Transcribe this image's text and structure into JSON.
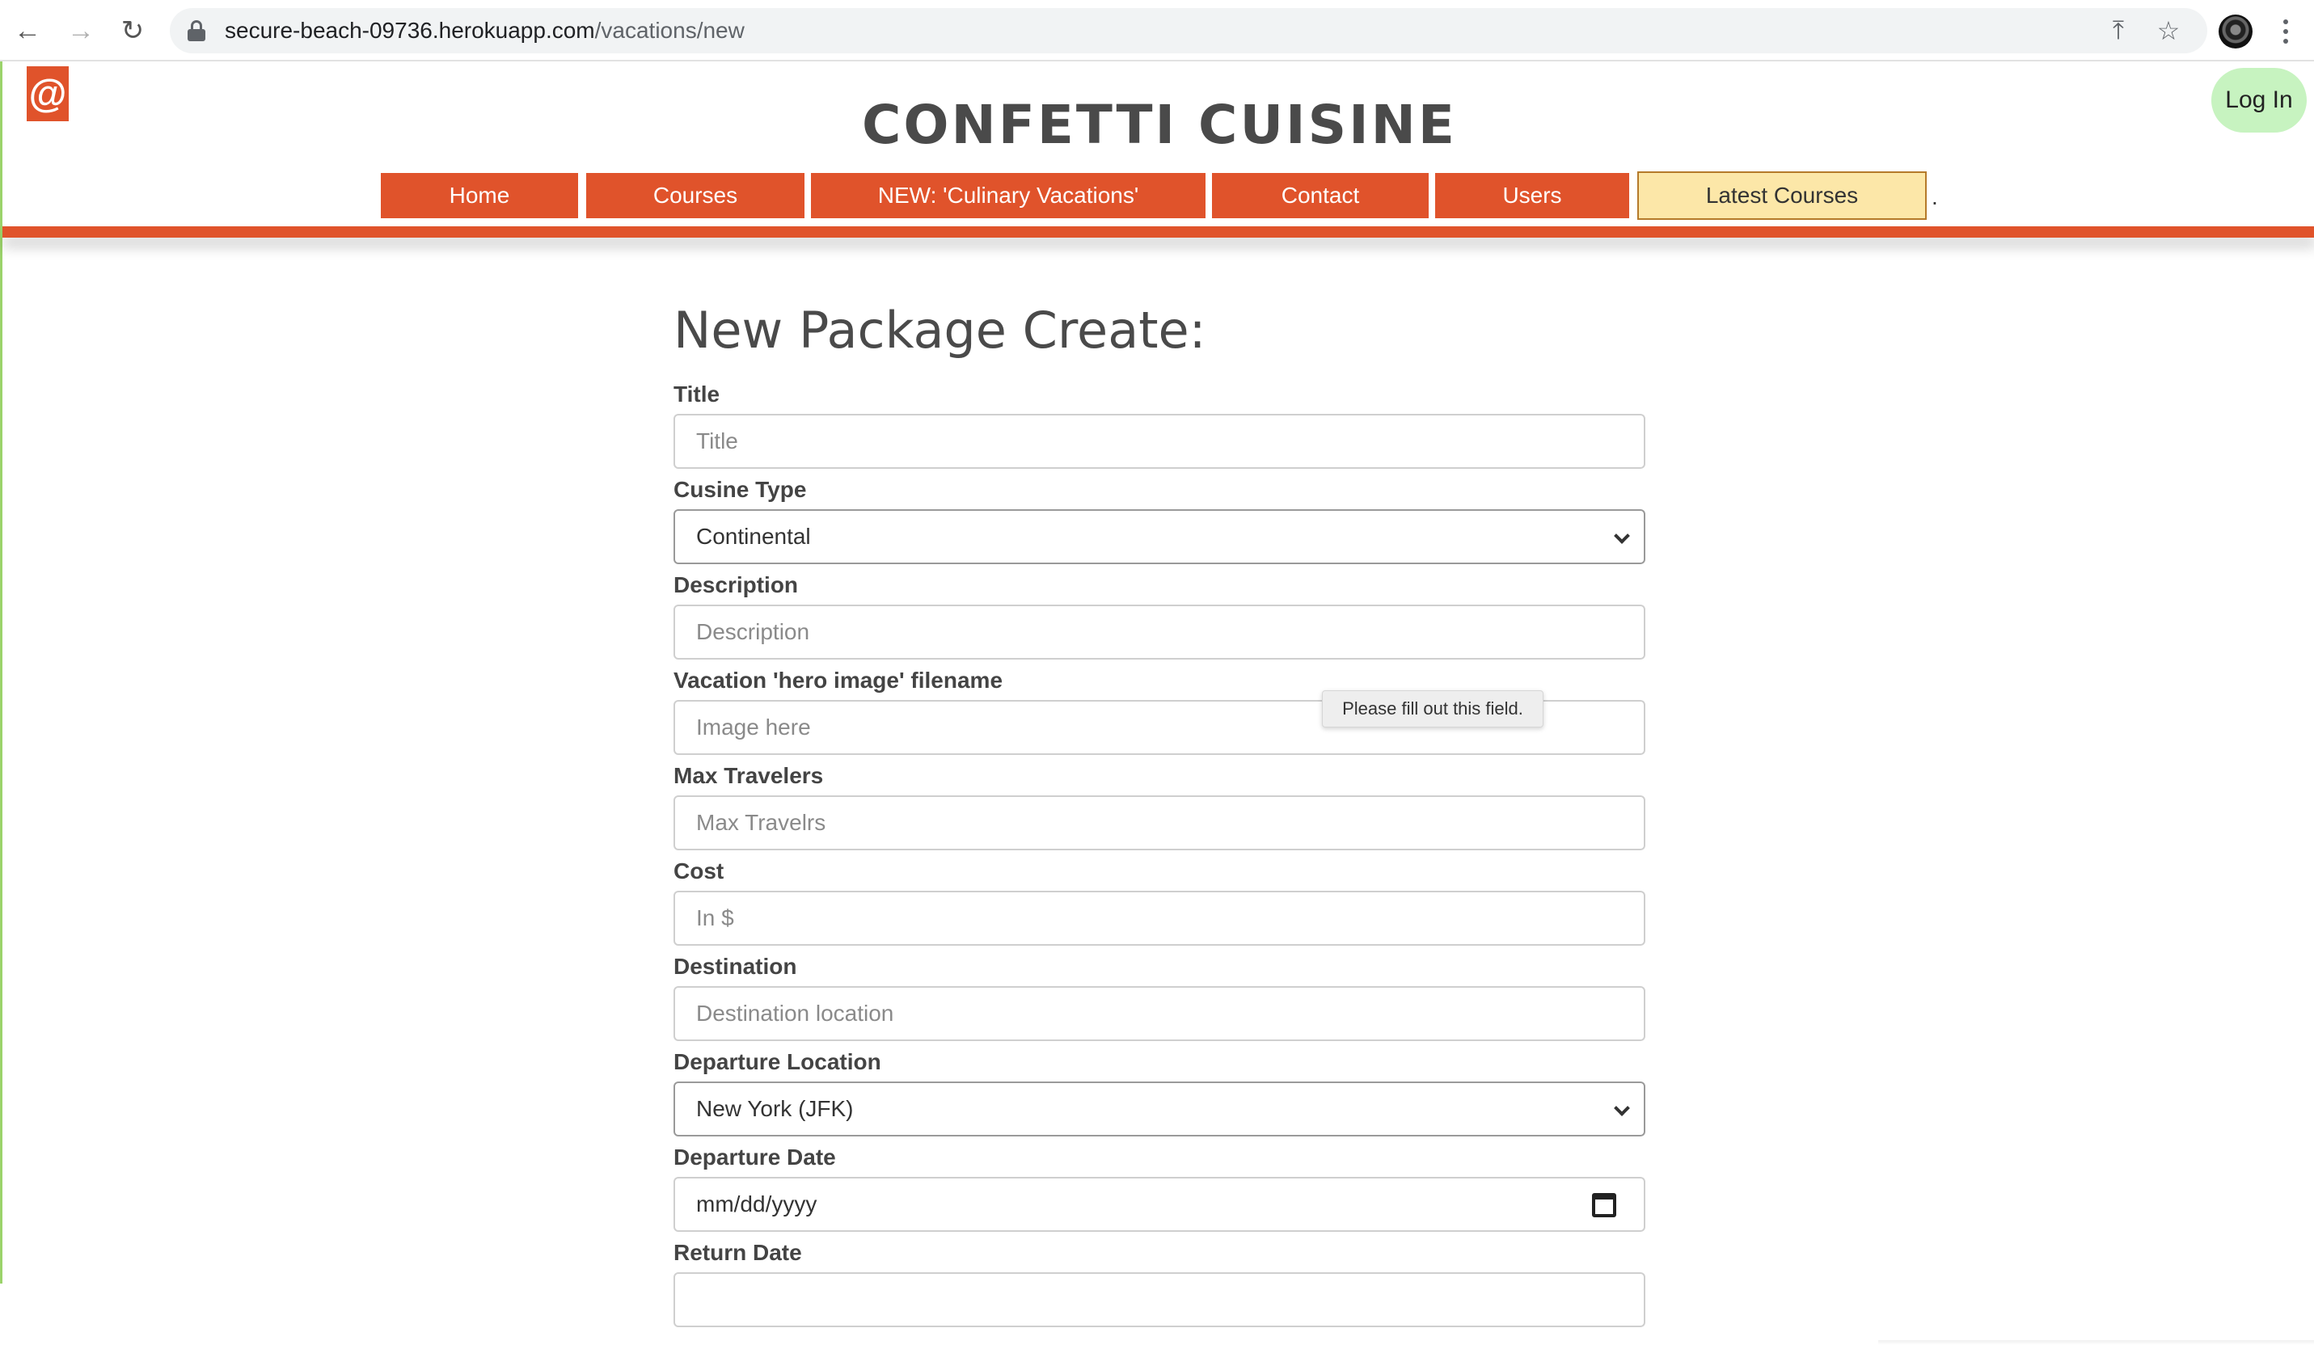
{
  "browser": {
    "url_domain": "secure-beach-09736.herokuapp.com",
    "url_path": "/vacations/new"
  },
  "header": {
    "logo_glyph": "@",
    "site_title": "CONFETTI CUISINE",
    "login_label": "Log In"
  },
  "nav": {
    "items": [
      {
        "label": "Home"
      },
      {
        "label": "Courses"
      },
      {
        "label": "NEW: 'Culinary Vacations'"
      },
      {
        "label": "Contact"
      },
      {
        "label": "Users"
      },
      {
        "label": "Latest Courses"
      }
    ],
    "trailing_text": "."
  },
  "form": {
    "heading": "New Package Create:",
    "fields": [
      {
        "label": "Title",
        "placeholder": "Title",
        "type": "text"
      },
      {
        "label": "Cusine Type",
        "value": "Continental",
        "type": "select"
      },
      {
        "label": "Description",
        "placeholder": "Description",
        "type": "text"
      },
      {
        "label": "Vacation 'hero image' filename",
        "placeholder": "Image here",
        "type": "text"
      },
      {
        "label": "Max Travelers",
        "placeholder": "Max Travelrs",
        "type": "text"
      },
      {
        "label": "Cost",
        "placeholder": "In $",
        "type": "text"
      },
      {
        "label": "Destination",
        "placeholder": "Destination location",
        "type": "text"
      },
      {
        "label": "Departure Location",
        "value": "New York (JFK)",
        "type": "select"
      },
      {
        "label": "Departure Date",
        "value": "mm/dd/yyyy",
        "type": "date"
      },
      {
        "label": "Return Date",
        "type": "date"
      }
    ],
    "validation_tooltip": "Please fill out this field."
  },
  "colors": {
    "brand_red": "#e0532b",
    "highlight_yellow": "#fce7a8",
    "login_green": "#c7f3c0"
  }
}
